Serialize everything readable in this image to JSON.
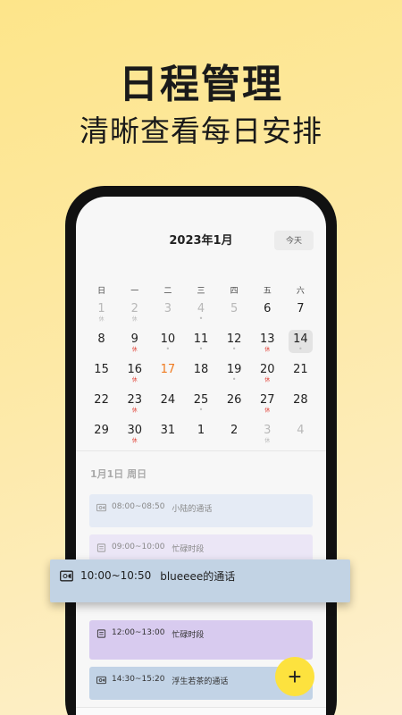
{
  "promo": {
    "title": "日程管理",
    "subtitle": "清晰查看每日安排"
  },
  "calendar": {
    "month_title": "2023年1月",
    "today_label": "今天",
    "weekdays": [
      "日",
      "一",
      "二",
      "三",
      "四",
      "五",
      "六"
    ],
    "days": [
      {
        "n": "1",
        "muted": true,
        "tag": "休"
      },
      {
        "n": "2",
        "muted": true,
        "tag": "休"
      },
      {
        "n": "3",
        "muted": true,
        "tag": ""
      },
      {
        "n": "4",
        "muted": true,
        "tag": "•"
      },
      {
        "n": "5",
        "muted": true,
        "tag": ""
      },
      {
        "n": "6",
        "tag": ""
      },
      {
        "n": "7",
        "tag": ""
      },
      {
        "n": "8",
        "tag": ""
      },
      {
        "n": "9",
        "tag": "休"
      },
      {
        "n": "10",
        "tag": "•"
      },
      {
        "n": "11",
        "tag": "•"
      },
      {
        "n": "12",
        "tag": "•"
      },
      {
        "n": "13",
        "tag": "休"
      },
      {
        "n": "14",
        "tag": "•",
        "selected": true
      },
      {
        "n": "15",
        "tag": ""
      },
      {
        "n": "16",
        "tag": "休"
      },
      {
        "n": "17",
        "tag": "",
        "today": true
      },
      {
        "n": "18",
        "tag": ""
      },
      {
        "n": "19",
        "tag": "•"
      },
      {
        "n": "20",
        "tag": "休"
      },
      {
        "n": "21",
        "tag": ""
      },
      {
        "n": "22",
        "tag": ""
      },
      {
        "n": "23",
        "tag": "休"
      },
      {
        "n": "24",
        "tag": ""
      },
      {
        "n": "25",
        "tag": "•"
      },
      {
        "n": "26",
        "tag": ""
      },
      {
        "n": "27",
        "tag": "休"
      },
      {
        "n": "28",
        "tag": ""
      },
      {
        "n": "29",
        "tag": ""
      },
      {
        "n": "30",
        "tag": "休"
      },
      {
        "n": "31",
        "tag": ""
      },
      {
        "n": "1",
        "tag": ""
      },
      {
        "n": "2",
        "tag": ""
      },
      {
        "n": "3",
        "muted": true,
        "tag": "休"
      },
      {
        "n": "4",
        "muted": true,
        "tag": ""
      }
    ]
  },
  "schedule": {
    "date_label": "1月1日  周日",
    "events": [
      {
        "time": "08:00~08:50",
        "title": "小陆的通话",
        "icon": "video-call-icon"
      },
      {
        "time": "09:00~10:00",
        "title": "忙碌时段",
        "icon": "note-icon"
      },
      {
        "time": "12:00~13:00",
        "title": "忙碌时段",
        "icon": "note-icon"
      },
      {
        "time": "14:30~15:20",
        "title": "浮生若茶的通话",
        "icon": "video-call-icon"
      }
    ],
    "dragging_event": {
      "time": "10:00~10:50",
      "title": "blueeee的通话",
      "icon": "video-call-icon"
    }
  },
  "fab_label": "+",
  "tabs": [
    {
      "icon": "clock-icon"
    },
    {
      "icon": "calendar-icon"
    },
    {
      "icon": "person-icon"
    }
  ],
  "colors": {
    "accent_yellow": "#fde23e",
    "today_orange": "#f07b21",
    "holiday_red": "#e03c31"
  }
}
